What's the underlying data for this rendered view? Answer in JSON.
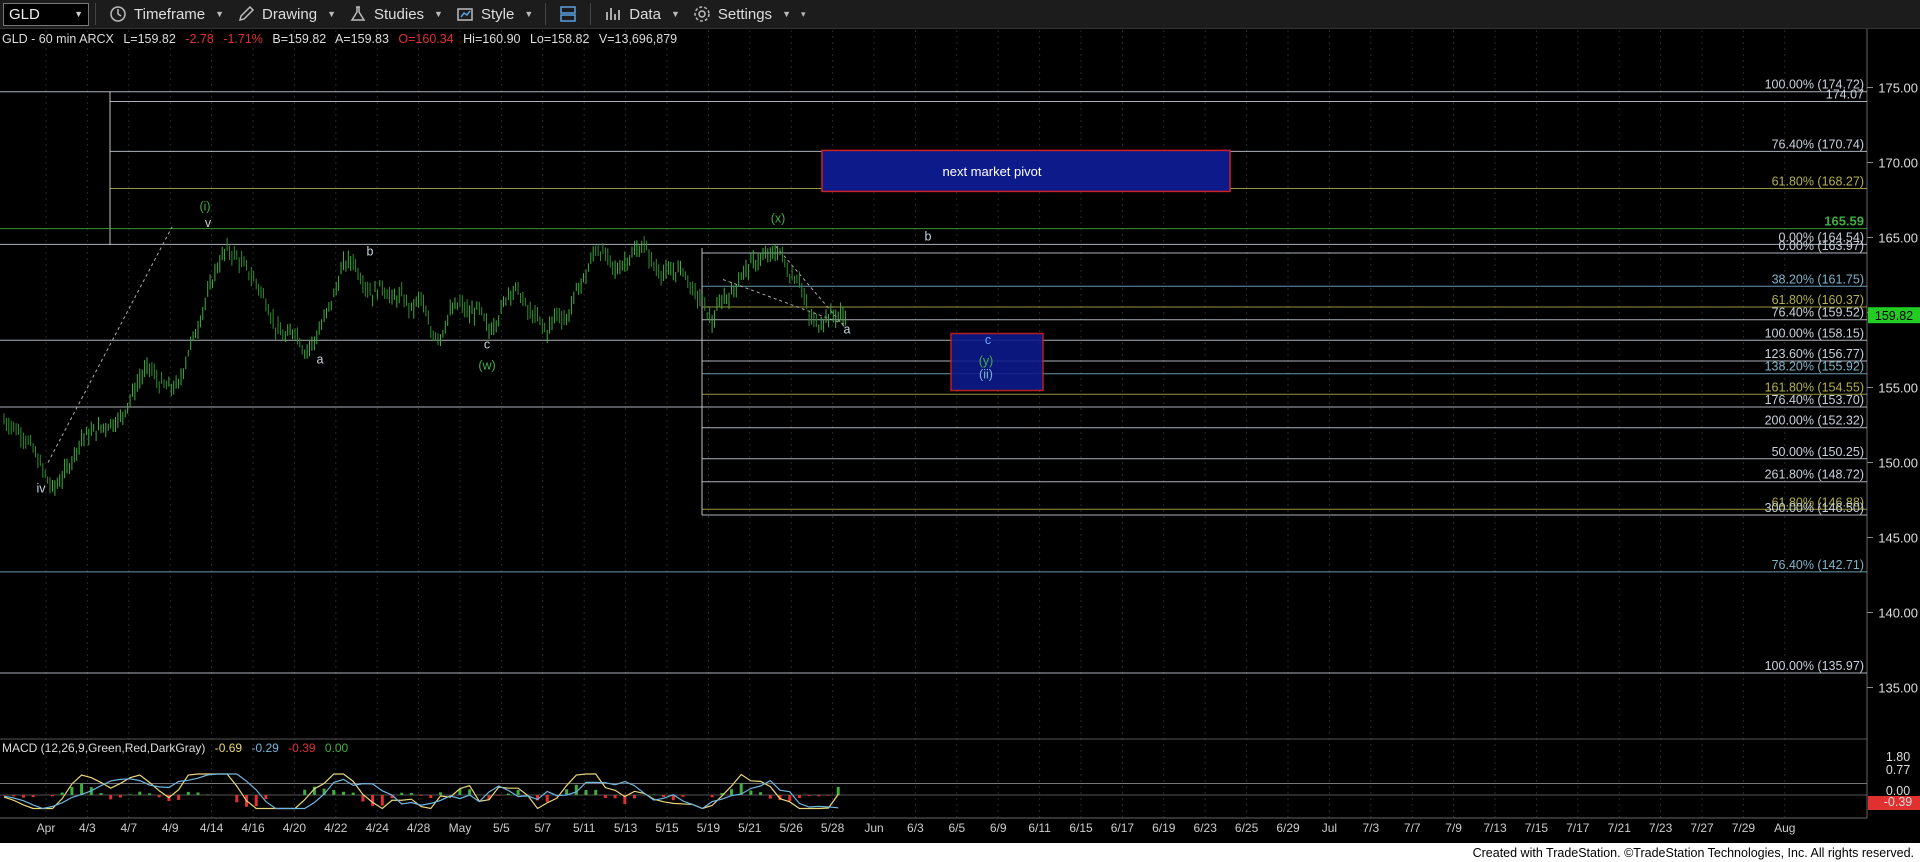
{
  "toolbar": {
    "symbol": "GLD",
    "timeframe_label": "Timeframe",
    "drawing_label": "Drawing",
    "studies_label": "Studies",
    "style_label": "Style",
    "data_label": "Data",
    "settings_label": "Settings"
  },
  "header": {
    "symbol_info": "GLD - 60 min  ARCX",
    "last": "L=159.82",
    "change": "-2.78",
    "change_pct": "-1.71%",
    "bid": "B=159.82",
    "ask": "A=159.83",
    "open": "O=160.34",
    "high": "Hi=160.90",
    "low": "Lo=158.82",
    "volume": "V=13,696,879"
  },
  "footer": {
    "credit": "Created with TradeStation. ©TradeStation Technologies, Inc. All rights reserved."
  },
  "colors": {
    "bullish": "#3fae3f",
    "bearish": "#e03030",
    "grid": "#2a2a2a",
    "fib_light": "#c8d2dc",
    "fib_teal": "#7fb3c8",
    "fib_olive": "#b4b04a",
    "price_marker": "#22cc22",
    "pivot_box": "#0d1a8a",
    "pivot_border": "#cc2222"
  },
  "chart_data": {
    "type": "line",
    "ylim": [
      131.5,
      177.5
    ],
    "price_axis_labels": [
      "175.00",
      "170.00",
      "165.00",
      "160.00",
      "155.00",
      "150.00",
      "145.00",
      "140.00",
      "135.00"
    ],
    "x_labels": [
      "Apr",
      "4/3",
      "4/7",
      "4/9",
      "4/14",
      "4/16",
      "4/20",
      "4/22",
      "4/24",
      "4/28",
      "May",
      "5/5",
      "5/7",
      "5/11",
      "5/13",
      "5/15",
      "5/19",
      "5/21",
      "5/26",
      "5/28",
      "Jun",
      "6/3",
      "6/5",
      "6/9",
      "6/11",
      "6/15",
      "6/17",
      "6/19",
      "6/23",
      "6/25",
      "6/29",
      "Jul",
      "7/3",
      "7/7",
      "7/9",
      "7/13",
      "7/15",
      "7/17",
      "7/21",
      "7/23",
      "7/27",
      "7/29",
      "Aug"
    ],
    "last_price": "159.82",
    "series": [
      {
        "x": [
          0,
          1,
          2,
          3,
          4,
          5,
          6,
          7,
          8,
          9,
          10,
          11,
          12,
          13,
          14,
          15,
          16,
          17,
          18,
          19,
          20,
          21,
          22,
          23,
          24,
          25,
          26,
          27,
          28,
          29,
          30,
          31,
          32,
          33,
          34,
          35,
          36,
          37,
          38,
          39,
          40,
          41,
          42,
          43,
          44,
          45,
          46,
          47,
          48,
          49,
          50,
          51,
          52,
          53,
          54,
          55,
          56,
          57,
          58,
          59,
          60,
          61,
          62,
          63,
          64,
          65,
          66,
          67,
          68,
          69,
          70,
          71,
          72,
          73,
          74,
          75,
          76,
          77,
          78,
          79,
          80,
          81,
          82,
          83,
          84,
          85,
          86,
          87,
          88,
          89,
          90,
          91,
          92,
          93,
          94,
          95,
          96,
          97,
          98
        ],
        "values": [
          152.8,
          152.4,
          151.8,
          150.9,
          149.5,
          148.2,
          149.0,
          150.2,
          151.6,
          152.0,
          152.3,
          152.6,
          152.9,
          154.2,
          155.6,
          156.4,
          155.3,
          155.0,
          155.1,
          157.4,
          159.1,
          161.2,
          163.1,
          164.2,
          163.7,
          162.9,
          162.0,
          160.8,
          159.0,
          158.3,
          158.9,
          157.4,
          158.1,
          159.5,
          161.1,
          163.2,
          163.5,
          162.1,
          161.2,
          161.8,
          160.9,
          161.1,
          160.2,
          161.0,
          158.7,
          158.4,
          160.0,
          160.6,
          159.9,
          160.2,
          158.8,
          159.7,
          161.4,
          161.5,
          160.1,
          159.6,
          158.7,
          160.0,
          159.5,
          161.4,
          162.5,
          164.3,
          163.8,
          162.8,
          163.4,
          164.0,
          164.5,
          163.1,
          162.6,
          162.7,
          162.9,
          161.4,
          160.8,
          159.3,
          160.9,
          161.2,
          162.5,
          163.2,
          163.6,
          163.8,
          164.1,
          162.5,
          162.3,
          159.7,
          159.2,
          159.82,
          159.82,
          159.82,
          159.82,
          159.82,
          159.82,
          159.82,
          159.82,
          159.82,
          159.82,
          159.82,
          159.82,
          159.82,
          159.82
        ]
      }
    ],
    "fib_levels": [
      {
        "label": "100.00% (174.72)",
        "value": 174.72,
        "color": "light"
      },
      {
        "label": "174.07",
        "value": 174.07,
        "color": "light"
      },
      {
        "label": "76.40% (170.74)",
        "value": 170.74,
        "color": "light"
      },
      {
        "label": "61.80% (168.27)",
        "value": 168.27,
        "color": "olive"
      },
      {
        "label": "165.59",
        "value": 165.59,
        "color": "green"
      },
      {
        "label": "0.00% (164.54)",
        "value": 164.54,
        "color": "light"
      },
      {
        "label": "0.00% (163.97)",
        "value": 163.97,
        "color": "light"
      },
      {
        "label": "38.20% (161.75)",
        "value": 161.75,
        "color": "teal"
      },
      {
        "label": "61.80% (160.37)",
        "value": 160.37,
        "color": "olive"
      },
      {
        "label": "76.40% (159.52)",
        "value": 159.52,
        "color": "light"
      },
      {
        "label": "100.00% (158.15)",
        "value": 158.15,
        "color": "light"
      },
      {
        "label": "123.60% (156.77)",
        "value": 156.77,
        "color": "light"
      },
      {
        "label": "138.20% (155.92)",
        "value": 155.92,
        "color": "teal"
      },
      {
        "label": "161.80% (154.55)",
        "value": 154.55,
        "color": "olive"
      },
      {
        "label": "176.40% (153.70)",
        "value": 153.7,
        "color": "light"
      },
      {
        "label": "200.00% (152.32)",
        "value": 152.32,
        "color": "light"
      },
      {
        "label": "50.00% (150.25)",
        "value": 150.25,
        "color": "light"
      },
      {
        "label": "261.80% (148.72)",
        "value": 148.72,
        "color": "light"
      },
      {
        "label": "61.80% (146.88)",
        "value": 146.88,
        "color": "olive"
      },
      {
        "label": "300.00% (146.50)",
        "value": 146.5,
        "color": "light"
      },
      {
        "label": "76.40% (142.71)",
        "value": 142.71,
        "color": "teal"
      },
      {
        "label": "100.00% (135.97)",
        "value": 135.97,
        "color": "light"
      }
    ],
    "annotations": [
      {
        "text": "(i)",
        "color": "green"
      },
      {
        "text": "v",
        "color": "light"
      },
      {
        "text": "b",
        "color": "light"
      },
      {
        "text": "a",
        "color": "light"
      },
      {
        "text": "c",
        "color": "light"
      },
      {
        "text": "(w)",
        "color": "green"
      },
      {
        "text": "(x)",
        "color": "green"
      },
      {
        "text": "a",
        "color": "light"
      },
      {
        "text": "b",
        "color": "light"
      },
      {
        "text": "iv",
        "color": "light"
      },
      {
        "text": "c",
        "color": "blue"
      },
      {
        "text": "(y)",
        "color": "green"
      },
      {
        "text": "(ii)",
        "color": "teal"
      }
    ],
    "pivot_box": {
      "label": "next market pivot",
      "top": 170.74,
      "bottom": 168.27
    },
    "target_box": {
      "top": 158.6,
      "bottom": 154.8
    }
  },
  "macd": {
    "title": "MACD (12,26,9,Green,Red,DarkGray)",
    "v1": "-0.69",
    "v2": "-0.29",
    "v3": "-0.39",
    "v4": "0.00",
    "axis_labels": [
      "1.80",
      "0.77",
      "0.00",
      "-0.39"
    ]
  }
}
